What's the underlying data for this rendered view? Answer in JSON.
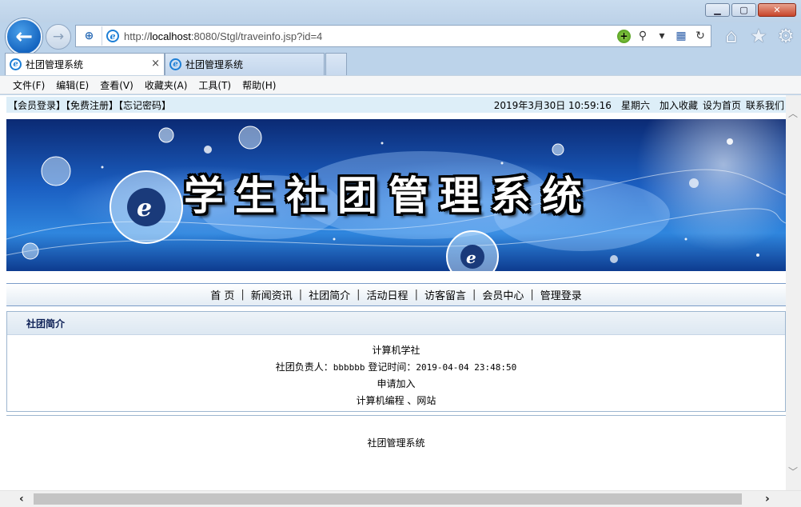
{
  "browser": {
    "url_prefix": "http://",
    "url_host": "localhost",
    "url_rest": ":8080/Stgl/traveinfo.jsp?id=4",
    "tabs": [
      {
        "label": "社团管理系统"
      },
      {
        "label": "社团管理系统"
      }
    ],
    "tab_close": "×",
    "menu": [
      "文件(F)",
      "编辑(E)",
      "查看(V)",
      "收藏夹(A)",
      "工具(T)",
      "帮助(H)"
    ],
    "icons": {
      "back": "←",
      "forward": "→",
      "shield": "⊕",
      "compat": "+",
      "search": "⚲",
      "dropdown": "▾",
      "rss": "▦",
      "refresh": "↻",
      "home": "⌂",
      "favorites": "★",
      "settings": "⚙",
      "ie": "e",
      "minimize": "▁",
      "maximize": "▢",
      "close": "✕"
    }
  },
  "page": {
    "topbar": {
      "login": "【会员登录】",
      "register": "【免费注册】",
      "forgot": "【忘记密码】",
      "datetime": "2019年3月30日 10:59:16",
      "weekday": "星期六",
      "bookmark": "加入收藏",
      "homepage": "设为首页",
      "contact": "联系我们"
    },
    "banner_title": "学生社团管理系统",
    "nav": [
      "首 页",
      "新闻资讯",
      "社团简介",
      "活动日程",
      "访客留言",
      "会员中心",
      "管理登录"
    ],
    "nav_separator": "|",
    "section_title": "社团简介",
    "club": {
      "name": "计算机学社",
      "leader_label": "社团负责人：",
      "leader": "bbbbbb",
      "reg_time_label": "登记时间：",
      "reg_time": "2019-04-04 23:48:50",
      "apply": "申请加入",
      "desc": "计算机编程 、网站"
    },
    "footer": "社团管理系统"
  }
}
